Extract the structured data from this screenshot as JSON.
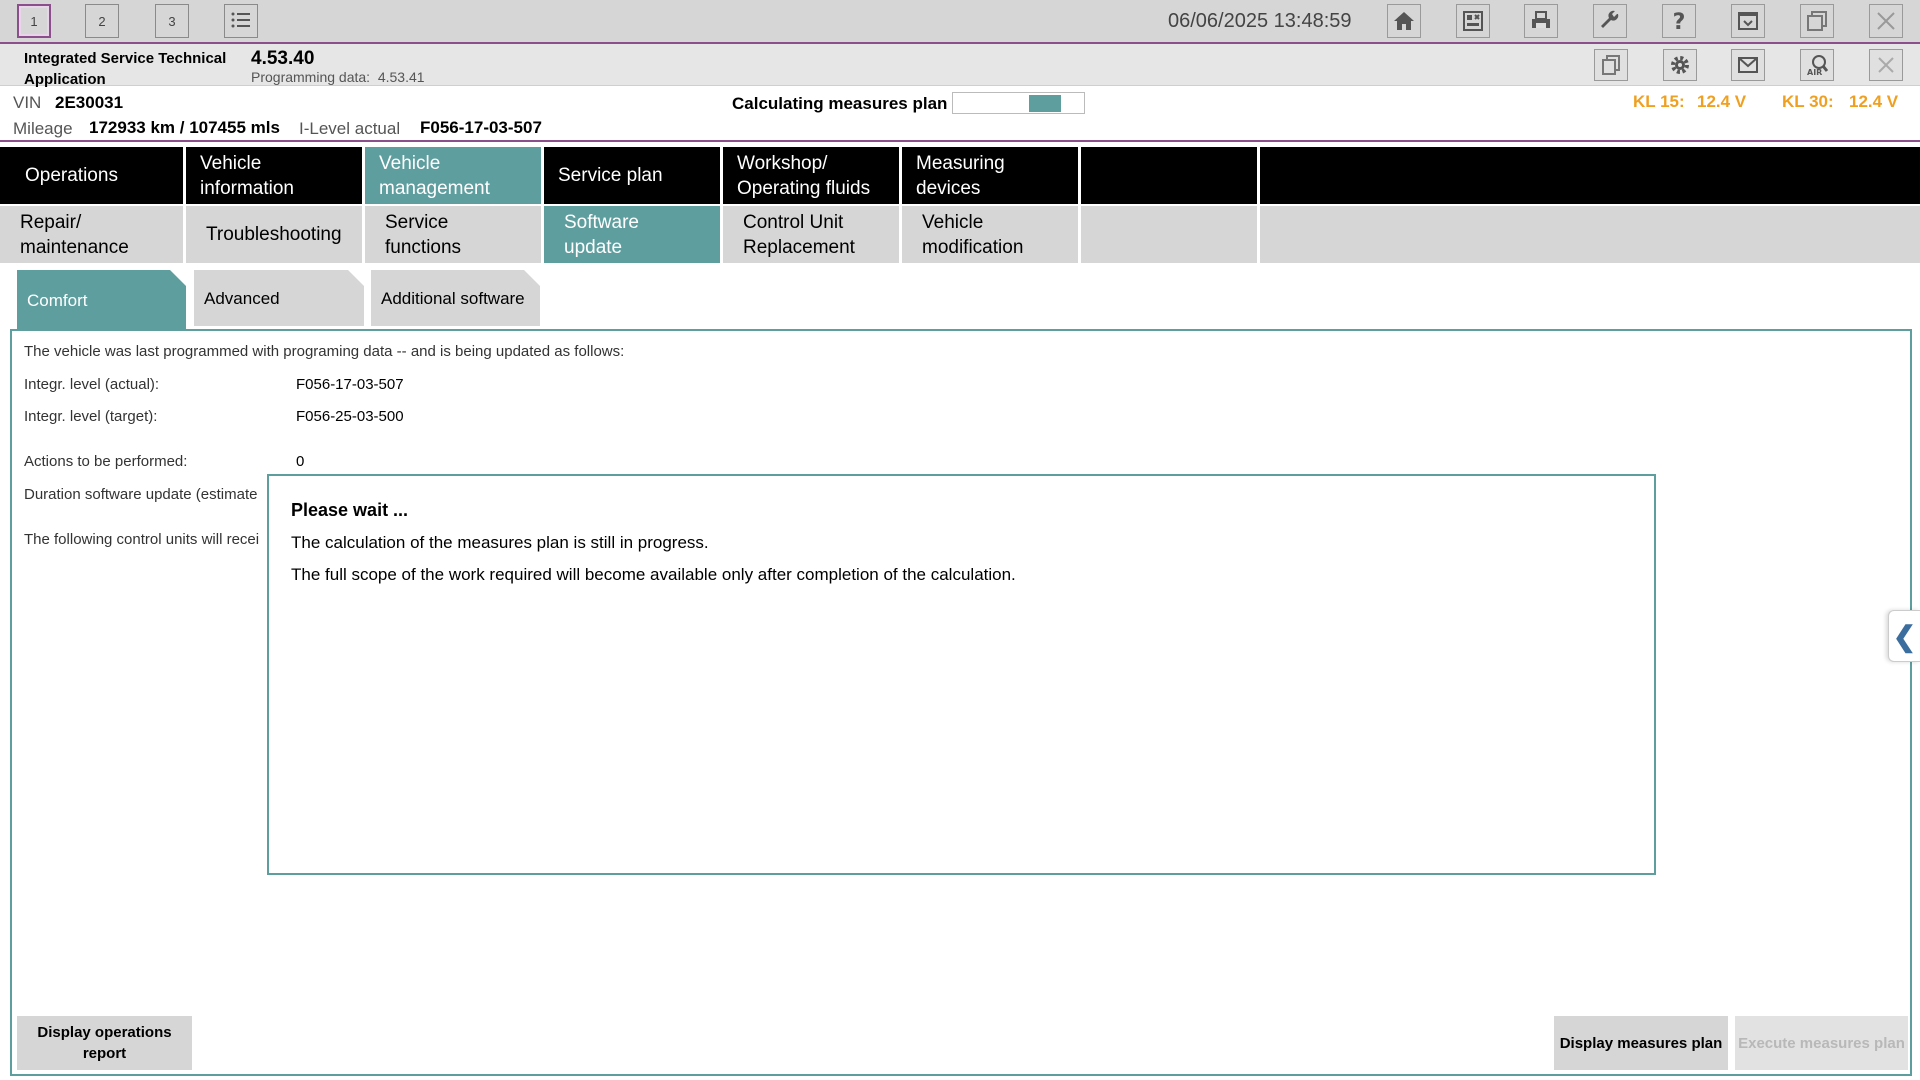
{
  "titlebar": {
    "sessions": [
      "1",
      "2",
      "3"
    ],
    "datetime": "06/06/2025 13:48:59"
  },
  "app": {
    "name": "Integrated Service Technical Application",
    "version": "4.53.40",
    "programming_data_label": "Programming data:",
    "programming_data_value": "4.53.41"
  },
  "vehicle": {
    "vin_label": "VIN",
    "vin": "2E30031",
    "mileage_label": "Mileage",
    "mileage": "172933 km / 107455 mls",
    "ilevel_label": "I-Level actual",
    "ilevel": "F056-17-03-507",
    "calc_label": "Calculating measures plan",
    "calc_progress": 0.63,
    "kl15_label": "KL 15:",
    "kl15": "12.4 V",
    "kl30_label": "KL 30:",
    "kl30": "12.4 V"
  },
  "nav_main": [
    "Operations",
    "Vehicle information",
    "Vehicle management",
    "Service plan",
    "Workshop/ Operating fluids",
    "Measuring devices"
  ],
  "nav_sub": [
    "Repair/ maintenance",
    "Troubleshooting",
    "Service functions",
    "Software update",
    "Control Unit Replacement",
    "Vehicle modification"
  ],
  "subtabs": [
    "Comfort",
    "Advanced",
    "Additional software"
  ],
  "content": {
    "intro": "The vehicle was last programmed with programing data -- and is being updated as follows:",
    "actual_label": "Integr. level (actual):",
    "actual_value": "F056-17-03-507",
    "target_label": "Integr. level (target):",
    "target_value": "F056-25-03-500",
    "actions_label": "Actions to be performed:",
    "actions_value": "0",
    "duration_label": "Duration software update (estimate",
    "following_label": "The following control units will recei"
  },
  "dialog": {
    "title": "Please wait ...",
    "line1": "The calculation of the measures plan is still in progress.",
    "line2": "The full scope of the work required will become available only after completion of the calculation."
  },
  "buttons": {
    "display_report": "Display operations report",
    "display_plan": "Display measures plan",
    "execute_plan": "Execute measures plan"
  },
  "colors": {
    "accent": "#5e9e9e",
    "frame": "#8b4f8b",
    "voltage": "#f0a020"
  }
}
